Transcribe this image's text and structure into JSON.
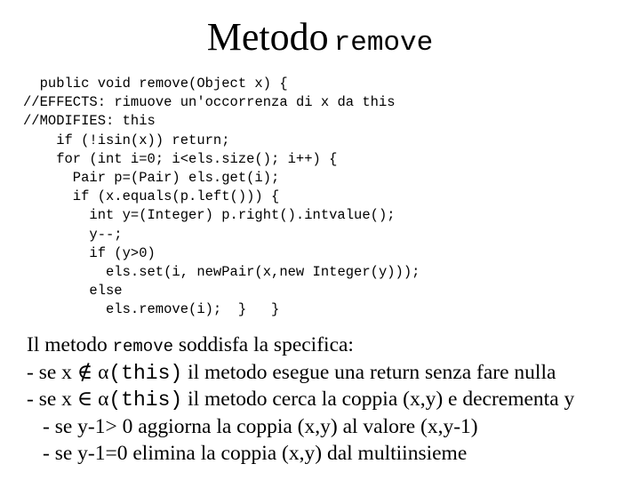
{
  "title": {
    "text": "Metodo",
    "code": "remove"
  },
  "code": {
    "lines": [
      {
        "indent": 2,
        "text": "public void remove(Object x) {"
      },
      {
        "indent": 0,
        "text": "//EFFECTS: rimuove un'occorrenza di x da this"
      },
      {
        "indent": 0,
        "text": "//MODIFIES: this"
      },
      {
        "indent": 4,
        "text": "if (!isin(x)) return;"
      },
      {
        "indent": 4,
        "text": "for (int i=0; i<els.size(); i++) {"
      },
      {
        "indent": 6,
        "text": "Pair p=(Pair) els.get(i);"
      },
      {
        "indent": 6,
        "text": "if (x.equals(p.left())) {"
      },
      {
        "indent": 8,
        "text": "int y=(Integer) p.right().intvalue();"
      },
      {
        "indent": 8,
        "text": "y--;"
      },
      {
        "indent": 8,
        "text": "if (y>0)"
      },
      {
        "indent": 10,
        "text": "els.set(i, newPair(x,new Integer(y)));"
      },
      {
        "indent": 8,
        "text": "else"
      },
      {
        "indent": 10,
        "text": "els.remove(i);  }   }"
      }
    ]
  },
  "prose": {
    "intro": {
      "before": "Il metodo ",
      "code": "remove",
      "after": " soddisfa la specifica:"
    },
    "case_not_in": {
      "prefix": "- se x ",
      "symbol": "∉",
      "alpha": " α",
      "code": "(this)",
      "after": " il metodo esegue una return senza fare nulla"
    },
    "case_in": {
      "prefix": "- se x ",
      "symbol": "∈",
      "alpha": " α",
      "code": "(this)",
      "after": " il metodo cerca la coppia (x,y) e decrementa y"
    },
    "sub_positive": "- se y-1> 0 aggiorna la coppia (x,y) al valore (x,y-1)",
    "sub_zero": "- se y-1=0 elimina la coppia (x,y) dal multiinsieme"
  }
}
